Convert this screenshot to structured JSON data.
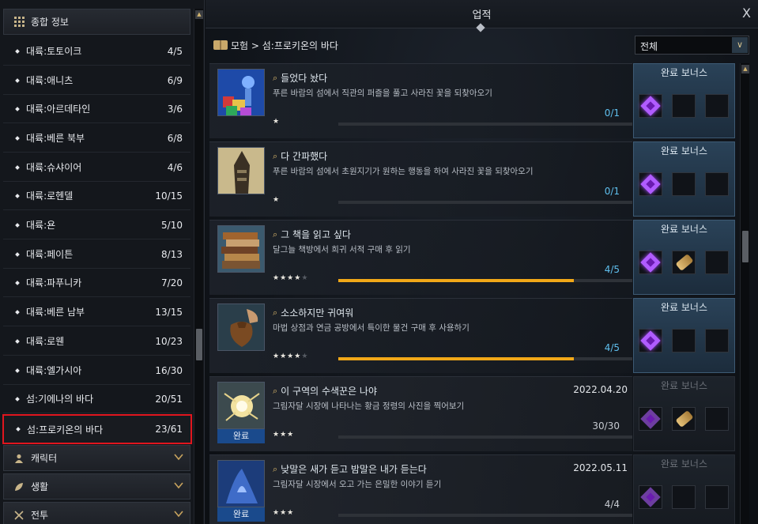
{
  "sidebar": {
    "sections": [
      {
        "label": "종합 정보",
        "icon": "grid-icon"
      },
      {
        "label": "캐릭터",
        "icon": "person-icon"
      },
      {
        "label": "생활",
        "icon": "leaf-icon"
      },
      {
        "label": "전투",
        "icon": "crossed-swords-icon"
      }
    ],
    "items": [
      {
        "label": "대륙:토토이크",
        "count": "4/5"
      },
      {
        "label": "대륙:애니츠",
        "count": "6/9"
      },
      {
        "label": "대륙:아르데타인",
        "count": "3/6"
      },
      {
        "label": "대륙:베른 북부",
        "count": "6/8"
      },
      {
        "label": "대륙:슈샤이어",
        "count": "4/6"
      },
      {
        "label": "대륙:로헨델",
        "count": "10/15"
      },
      {
        "label": "대륙:욘",
        "count": "5/10"
      },
      {
        "label": "대륙:페이튼",
        "count": "8/13"
      },
      {
        "label": "대륙:파푸니카",
        "count": "7/20"
      },
      {
        "label": "대륙:베른 남부",
        "count": "13/15"
      },
      {
        "label": "대륙:로웬",
        "count": "10/23"
      },
      {
        "label": "대륙:엘가시아",
        "count": "16/30"
      },
      {
        "label": "섬:기에나의 바다",
        "count": "20/51"
      },
      {
        "label": "섬:프로키온의 바다",
        "count": "23/61",
        "selected": true
      }
    ]
  },
  "header": {
    "title": "업적",
    "close_label": "X"
  },
  "breadcrumb": {
    "text": "모험 > 섬:프로키온의 바다"
  },
  "filter": {
    "selected": "전체",
    "arrow": "∨"
  },
  "bonus_title": "완료 보너스",
  "done_label": "완료",
  "achievements": [
    {
      "name": "들었다 놨다",
      "desc": "푸른 바람의 섬에서 직관의 퍼즐을 풀고 사라진 꽃을 되찾아오기",
      "progress_text": "0/1",
      "progress": 0,
      "stars": 1,
      "stars_max": 1,
      "date": "",
      "completed": false,
      "rewards": [
        "gem",
        "",
        ""
      ]
    },
    {
      "name": "다 간파했다",
      "desc": "푸른 바람의 섬에서 초원지기가 원하는 행동을 하여 사라진 꽃을 되찾아오기",
      "progress_text": "0/1",
      "progress": 0,
      "stars": 1,
      "stars_max": 1,
      "date": "",
      "completed": false,
      "rewards": [
        "gem",
        "",
        ""
      ]
    },
    {
      "name": "그 책을 읽고 싶다",
      "desc": "달그늘 책방에서 희귀 서적 구매 후 읽기",
      "progress_text": "4/5",
      "progress": 0.8,
      "stars": 4,
      "stars_max": 5,
      "date": "",
      "completed": false,
      "rewards": [
        "gem",
        "scroll",
        ""
      ]
    },
    {
      "name": "소소하지만 귀여워",
      "desc": "마법 상점과 연금 공방에서 특이한 물건 구매 후 사용하기",
      "progress_text": "4/5",
      "progress": 0.8,
      "stars": 4,
      "stars_max": 5,
      "date": "",
      "completed": false,
      "rewards": [
        "gem",
        "",
        ""
      ]
    },
    {
      "name": "이 구역의 수색꾼은 나야",
      "desc": "그림자달 시장에 나타나는 황금 정령의 사진을 찍어보기",
      "progress_text": "30/30",
      "progress": 1,
      "stars": 3,
      "stars_max": 3,
      "date": "2022.04.20",
      "completed": true,
      "rewards": [
        "gem",
        "scroll",
        ""
      ]
    },
    {
      "name": "낮말은 새가 듣고 밤말은 내가 듣는다",
      "desc": "그림자달 시장에서 오고 가는 은밀한 이야기 듣기",
      "progress_text": "4/4",
      "progress": 1,
      "stars": 3,
      "stars_max": 3,
      "date": "2022.05.11",
      "completed": true,
      "rewards": [
        "gem",
        "",
        ""
      ]
    }
  ],
  "colors": {
    "selected_border": "#e0161e",
    "progress_fill": "#f1a818",
    "progress_text": "#5fc0ef",
    "done_tag": "#1a4a8c",
    "bonus_active": "#2a4258"
  }
}
